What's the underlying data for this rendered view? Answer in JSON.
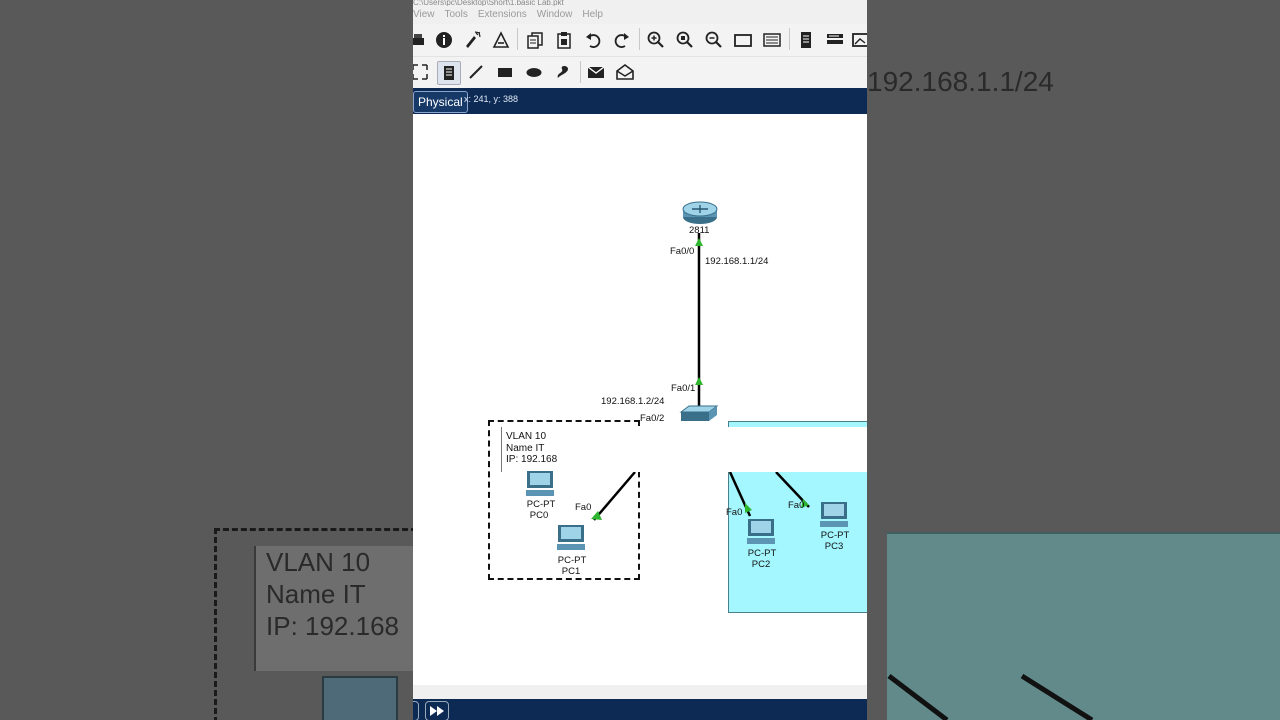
{
  "window": {
    "path_partial": "C:\\Users\\pc\\Desktop\\Short\\1.basic Lab.pkt"
  },
  "menu": [
    "View",
    "Tools",
    "Extensions",
    "Window",
    "Help"
  ],
  "toolbar_icons": [
    "print-icon",
    "info-icon",
    "activity-wizard-icon",
    "custom-device-icon",
    "copy-icon",
    "paste-icon",
    "undo-icon",
    "redo-icon",
    "zoom-in-icon",
    "zoom-reset-icon",
    "zoom-out-icon",
    "drawing-palette-icon",
    "custom-devices-dialog-icon",
    "view-icon",
    "network-info-icon",
    "screenshot-icon"
  ],
  "drawing_tools": [
    "select-icon",
    "note-icon",
    "line-icon",
    "rectangle-icon",
    "ellipse-icon",
    "freeform-icon",
    "simple-pdu-icon",
    "complex-pdu-icon"
  ],
  "view": {
    "tab_label": "Physical",
    "coords": "x: 241, y: 388"
  },
  "topology": {
    "router_label": "2811",
    "router_port": "Fa0/0",
    "router_ip": "192.168.1.1/24",
    "switch_uplink_port": "Fa0/1",
    "switch_ip": "192.168.1.2/24",
    "switch_port_2": "Fa0/2",
    "note": [
      "VLAN 10",
      "Name IT",
      "IP: 192.168"
    ],
    "pcs": [
      {
        "type": "PC-PT",
        "name": "PC0"
      },
      {
        "type": "PC-PT",
        "name": "PC1",
        "port": "Fa0"
      },
      {
        "type": "PC-PT",
        "name": "PC2",
        "port": "Fa0"
      },
      {
        "type": "PC-PT",
        "name": "PC3",
        "port": "Fa0"
      }
    ]
  },
  "background_echo": {
    "ip": "192.168.1.1/24",
    "note": [
      "VLAN 10",
      "Name IT",
      "IP: 192.168"
    ]
  }
}
